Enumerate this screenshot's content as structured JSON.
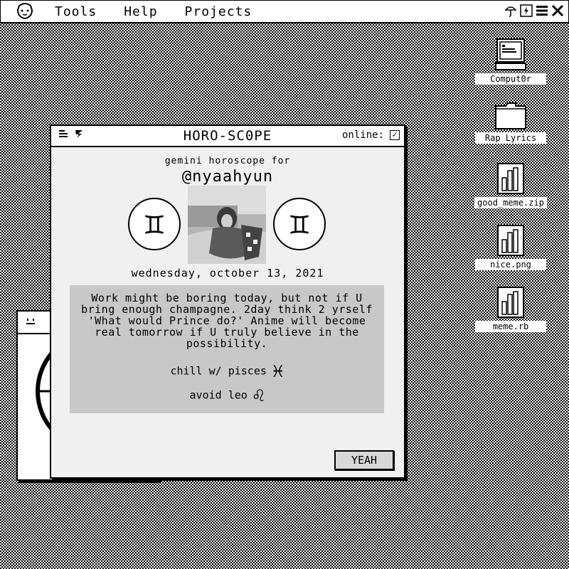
{
  "menubar": {
    "items": [
      "Tools",
      "Help",
      "Projects"
    ],
    "system_icons": [
      "umbrella-icon",
      "battery-icon",
      "menu-icon",
      "close-icon"
    ]
  },
  "desktop_icons": [
    {
      "label": "Comput0r",
      "icon": "computer-icon"
    },
    {
      "label": "Rap Lyrics",
      "icon": "folder-icon"
    },
    {
      "label": "good_meme.zip",
      "icon": "file-chart-icon"
    },
    {
      "label": "nice.png",
      "icon": "file-chart-icon"
    },
    {
      "label": "meme.rb",
      "icon": "file-chart-icon"
    }
  ],
  "window": {
    "title": "HORO-SC0PE",
    "online_label": "online:",
    "online_checked": "✓",
    "subtitle": "gemini horoscope for",
    "handle": "@nyaahyun",
    "sign_symbol": "♊",
    "date": "wednesday, october 13, 2021",
    "reading": "Work might be boring today, but not if U bring enough champagne. 2day think 2 yrself 'What would Prince do?' Anime will become real tomorrow if U truly believe in the possibility.",
    "chill": {
      "label": "chill w/ pisces",
      "symbol": "♓"
    },
    "avoid": {
      "label": "avoid leo",
      "symbol": "♌"
    },
    "button_label": "YEAH"
  }
}
